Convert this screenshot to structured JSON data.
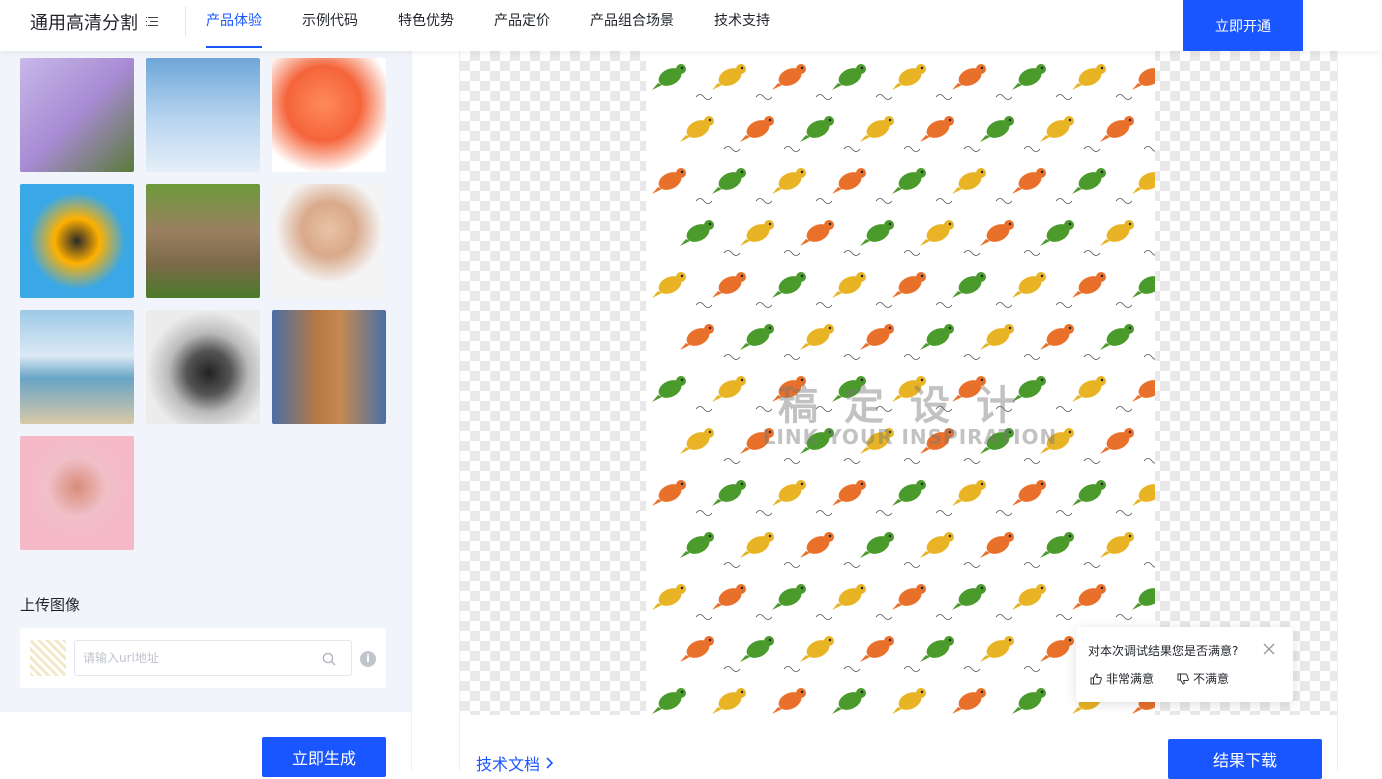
{
  "header": {
    "title": "通用高清分割",
    "nav": [
      "产品体验",
      "示例代码",
      "特色优势",
      "产品定价",
      "产品组合场景",
      "技术支持"
    ],
    "active_nav": "产品体验",
    "cta_label": "立即开通"
  },
  "left": {
    "upload_title": "上传图像",
    "url_placeholder": "请输入url地址",
    "info_icon": "i",
    "generate_label": "立即生成"
  },
  "result": {
    "watermark_cn": "稿定设计",
    "watermark_en": "LINK YOUR INSPIRATION",
    "doc_link_label": "技术文档",
    "download_label": "结果下载"
  },
  "feedback": {
    "question": "对本次调试结果您是否满意?",
    "positive": "非常满意",
    "negative": "不满意"
  },
  "colors": {
    "accent": "#1a56ff",
    "left_bg": "#f2f4fb",
    "bird_green": "#4a9a2c",
    "bird_yellow": "#e8b425",
    "bird_orange": "#e8702a"
  }
}
